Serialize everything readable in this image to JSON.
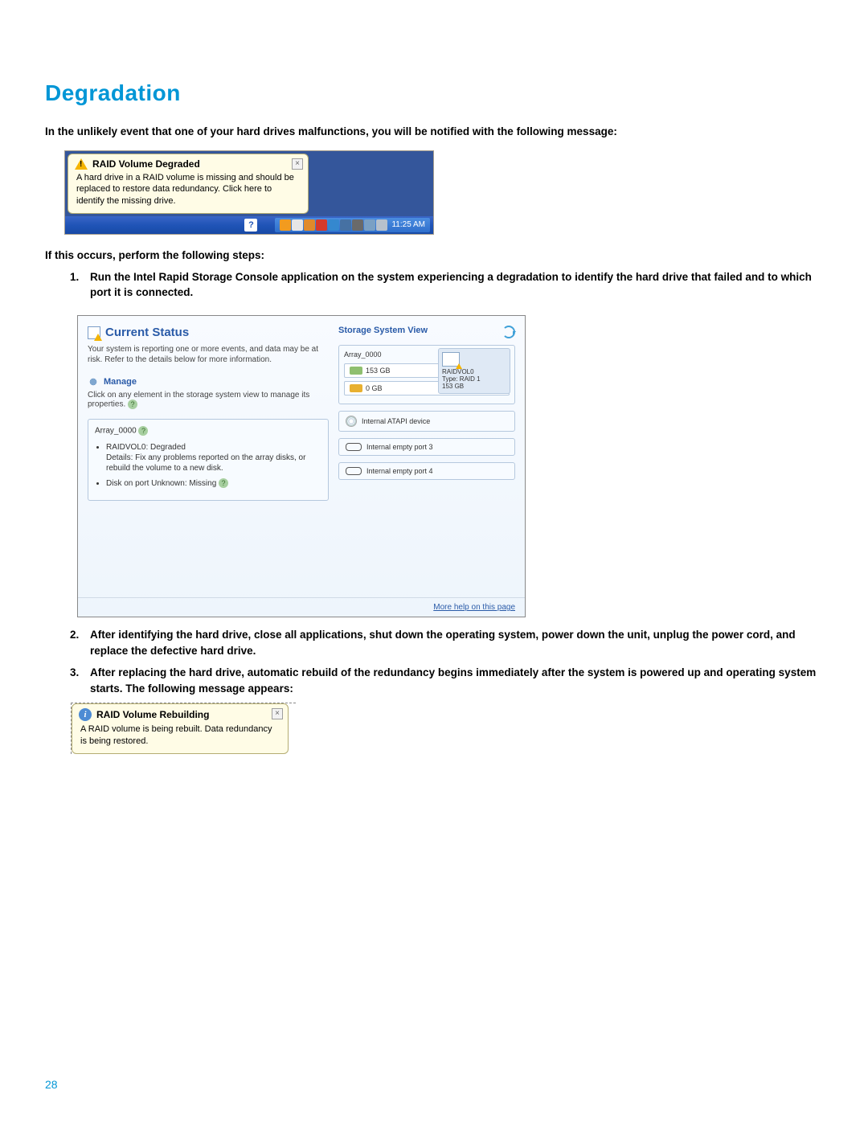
{
  "heading": "Degradation",
  "intro": "In the unlikely event that one of your hard drives malfunctions, you will be notified with the following message:",
  "balloon1": {
    "title": "RAID Volume Degraded",
    "text": "A hard drive in a RAID volume is missing and should be replaced to restore data redundancy. Click here to identify the missing drive."
  },
  "taskbar_time": "11:25 AM",
  "subintro": "If this occurs, perform the following steps:",
  "step1": "Run the Intel Rapid Storage Console application on the system experiencing a degradation to identify the hard drive that failed and to which port it is connected.",
  "console": {
    "title": "Current Status",
    "desc": "Your system is reporting one or more events, and data may be at risk. Refer to the details below for more information.",
    "manage_title": "Manage",
    "manage_text": "Click on any element in the storage system view to manage its properties.",
    "array_name": "Array_0000",
    "raid_status": "RAIDVOL0:  Degraded",
    "raid_details": "Details: Fix any problems reported on the array disks, or rebuild the volume to a new disk.",
    "disk_missing": "Disk on port Unknown:  Missing",
    "right_title": "Storage System View",
    "array_label": "Array_0000",
    "disk1": "153 GB",
    "disk2": "0 GB",
    "vol_name": "RAIDVOL0",
    "vol_type": "Type: RAID 1",
    "vol_size": "153 GB",
    "atapi": "Internal ATAPI device",
    "port3": "Internal empty port 3",
    "port4": "Internal empty port 4",
    "help_link": "More help on this page"
  },
  "step2": "After identifying the hard drive, close all applications, shut down the operating system, power down the unit, unplug the power cord, and replace the defective hard drive.",
  "step3": "After replacing the hard drive, automatic rebuild of the redundancy begins immediately after the system is powered up and operating system starts. The following message appears:",
  "balloon2": {
    "title": "RAID Volume Rebuilding",
    "text": "A RAID volume is being rebuilt. Data redundancy is being restored."
  },
  "page_number": "28"
}
